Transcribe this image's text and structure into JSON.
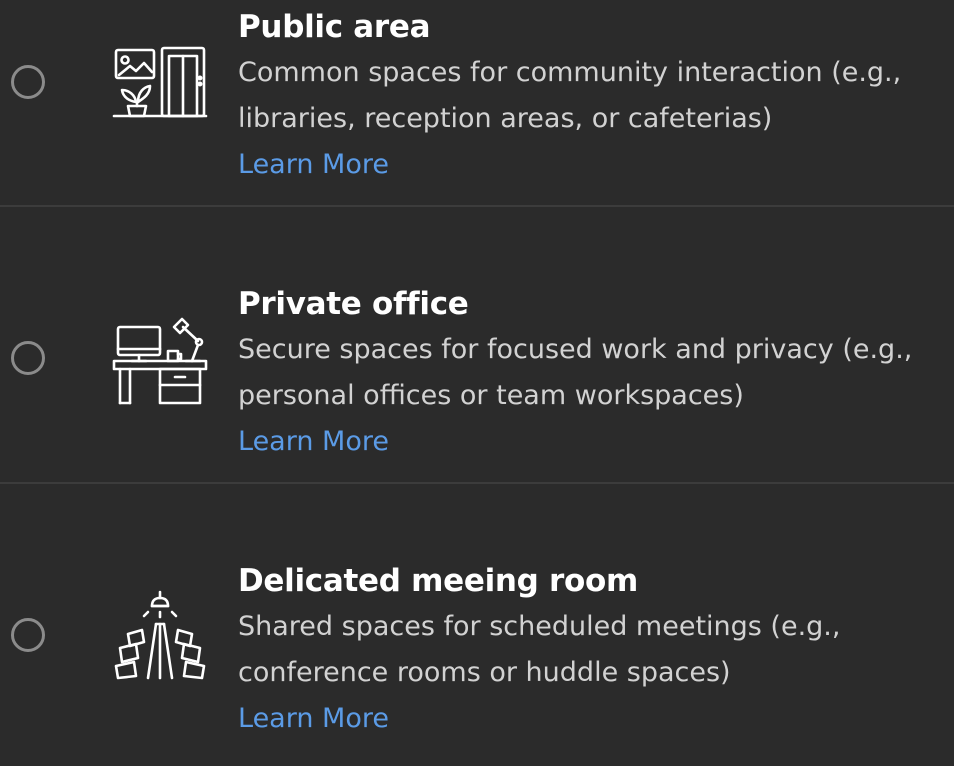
{
  "options": [
    {
      "title": "Public area",
      "desc_line1": "Common spaces for community interaction (e.g.,",
      "desc_line2": "libraries, reception areas, or cafeterias)",
      "link": "Learn More",
      "icon": "public-area-icon"
    },
    {
      "title": "Private office",
      "desc_line1": "Secure spaces for focused work and privacy (e.g.,",
      "desc_line2": "personal offices or team workspaces)",
      "link": "Learn More",
      "icon": "private-office-icon"
    },
    {
      "title": "Delicated meeing room",
      "desc_line1": "Shared spaces for scheduled meetings (e.g.,",
      "desc_line2": "conference rooms or huddle spaces)",
      "link": "Learn More",
      "icon": "meeting-room-icon"
    }
  ],
  "colors": {
    "background": "#2b2b2b",
    "divider": "#3c3c3c",
    "title": "#ffffff",
    "description": "#d2d2d2",
    "link": "#5b9be6",
    "radio_border": "#8b8b8b"
  }
}
